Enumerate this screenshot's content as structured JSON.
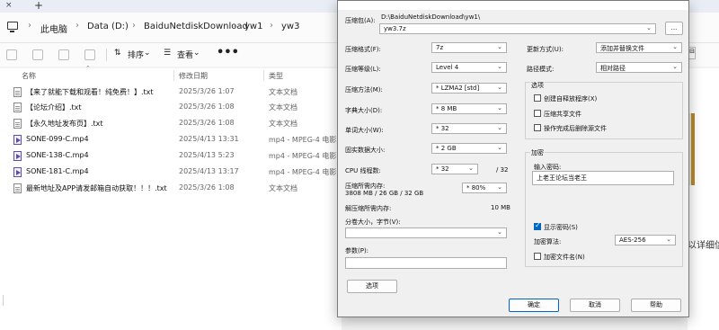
{
  "explorer": {
    "tab_close": "×",
    "tab_new": "+",
    "breadcrumb": [
      "此电脑",
      "Data (D:)",
      "BaiduNetdiskDownload",
      "yw1",
      "yw3"
    ],
    "toolbar": {
      "sort_label": "排序",
      "view_label": "查看",
      "more_label": "•••"
    },
    "columns": {
      "name": "名称",
      "date": "修改日期",
      "type": "类型"
    },
    "files": [
      {
        "name": "【来了就能下载和观看！纯免费！】.txt",
        "date": "2025/3/26 1:07",
        "type": "文本文档",
        "icon": "text-file-icon"
      },
      {
        "name": "【论坛介绍】.txt",
        "date": "2025/3/26 1:08",
        "type": "文本文档",
        "icon": "text-file-icon"
      },
      {
        "name": "【永久地址发布页】.txt",
        "date": "2025/3/26 1:08",
        "type": "文本文档",
        "icon": "text-file-icon"
      },
      {
        "name": "SONE-099-C.mp4",
        "date": "2025/4/13 13:31",
        "type": "mp4 - MPEG-4 电影...",
        "icon": "video-file-icon"
      },
      {
        "name": "SONE-138-C.mp4",
        "date": "2025/4/13 5:23",
        "type": "mp4 - MPEG-4 电影...",
        "icon": "video-file-icon"
      },
      {
        "name": "SONE-181-C.mp4",
        "date": "2025/4/13 13:17",
        "type": "mp4 - MPEG-4 电影...",
        "icon": "video-file-icon"
      },
      {
        "name": "最新地址及APP请发邮箱自动获取！！！.txt",
        "date": "2025/3/26 1:08",
        "type": "文本文档",
        "icon": "text-file-icon"
      }
    ],
    "right_panel_fragment": "以详细信息"
  },
  "dialog": {
    "archive_label": "压缩包(A):",
    "archive_path": "D:\\BaiduNetdiskDownload\\yw1\\",
    "archive_name": "yw3.7z",
    "browse_label": "...",
    "left_fields": [
      {
        "label": "压缩格式(F):",
        "value": "7z"
      },
      {
        "label": "压缩等级(L):",
        "value": "Level 4"
      },
      {
        "label": "压缩方法(M):",
        "value": "* LZMA2 [std]"
      },
      {
        "label": "字典大小(D):",
        "value": "* 8 MB"
      },
      {
        "label": "单词大小(W):",
        "value": "* 32"
      },
      {
        "label": "固实数据大小:",
        "value": "* 2 GB"
      }
    ],
    "cpu_threads_label": "CPU 线程数:",
    "cpu_threads_value": "* 32",
    "cpu_threads_max": "/ 32",
    "memory_label": "压缩所需内存:",
    "memory_detail": "3808 MB / 26 GB / 32 GB",
    "memory_percent": "* 80%",
    "decompress_mem_label": "解压缩所需内存:",
    "decompress_mem_value": "10 MB",
    "split_label": "分卷大小，字节(V):",
    "split_value": "",
    "params_label": "参数(P):",
    "params_value": "",
    "options_button": "选项",
    "update_label": "更新方式(U):",
    "update_value": "添加并替换文件",
    "path_mode_label": "路径模式:",
    "path_mode_value": "相对路径",
    "options_group": "选项",
    "opt_sfx": "创建自释放程序(X)",
    "opt_shared": "压缩共享文件",
    "opt_delete": "操作完成后删除源文件",
    "encrypt_group": "加密",
    "password_label": "输入密码:",
    "password_value": "上老王论坛当老王",
    "show_password": "显示密码(S)",
    "encrypt_method_label": "加密算法:",
    "encrypt_method_value": "AES-256",
    "encrypt_names": "加密文件名(N)",
    "ok": "确定",
    "cancel": "取消",
    "help": "帮助"
  }
}
